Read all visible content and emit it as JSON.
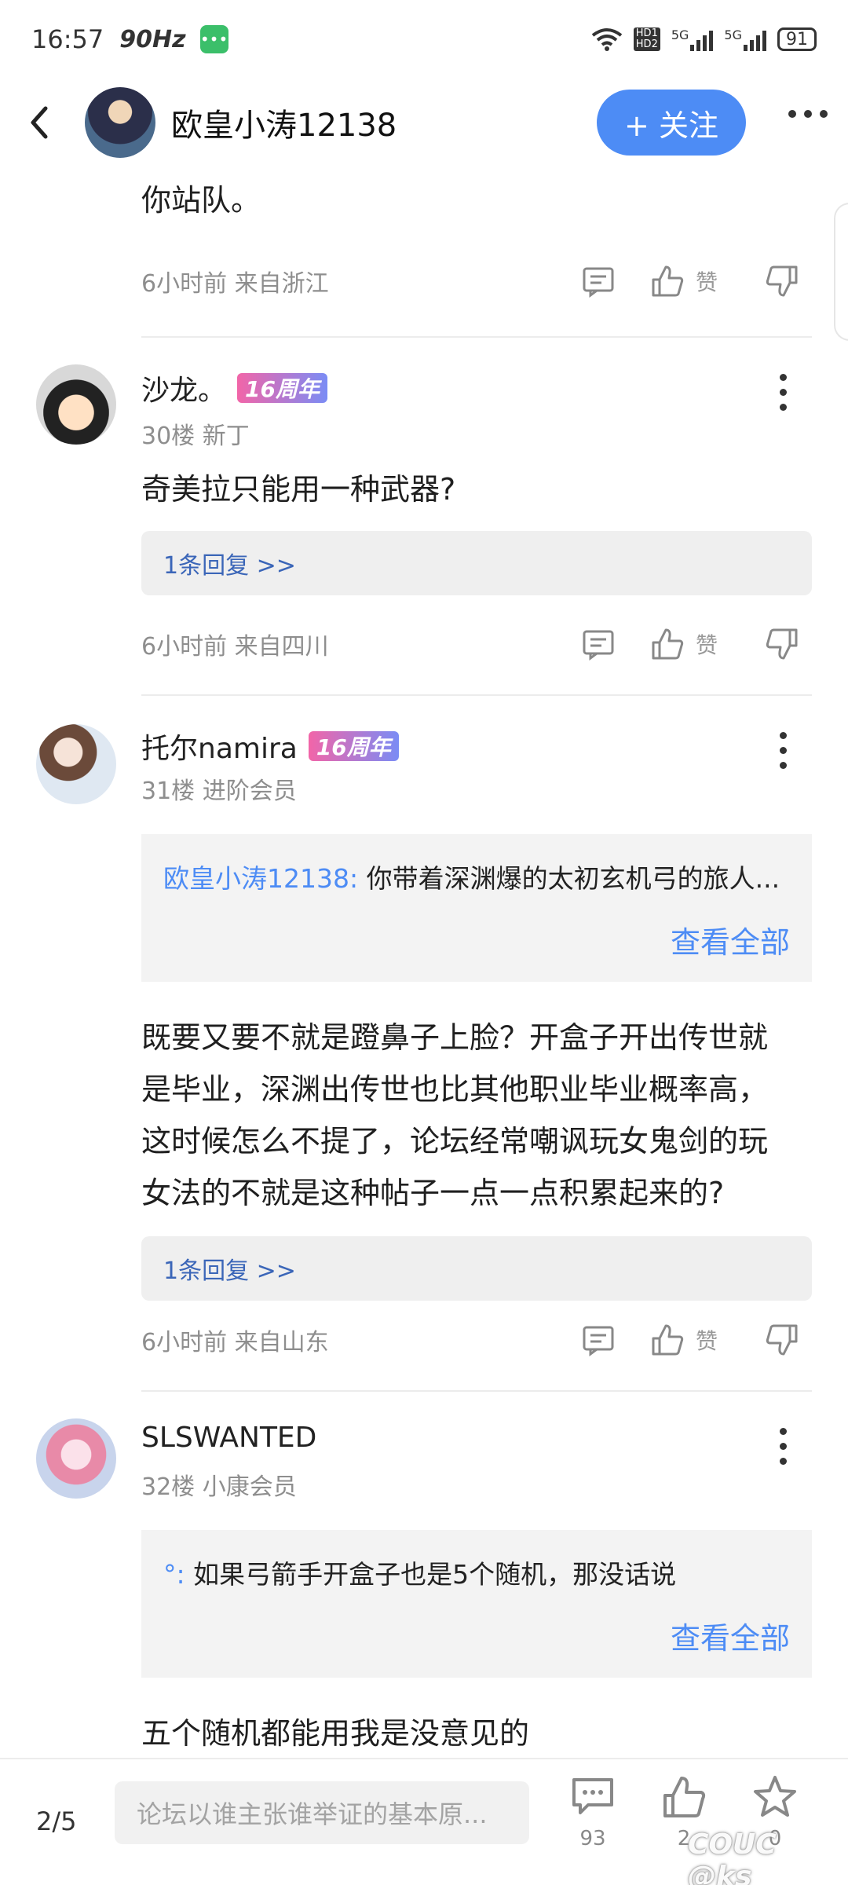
{
  "status_bar": {
    "time": "16:57",
    "refresh_rate": "90Hz",
    "hd1": "HD1",
    "hd2": "HD2",
    "net1": "5G",
    "net2": "5G",
    "battery": "91"
  },
  "header": {
    "username": "欧皇小涛12138",
    "follow_label": "+ 关注"
  },
  "top_fragment": {
    "text": "你站队。",
    "meta": "6小时前 来自浙江",
    "like_label": "赞"
  },
  "comments": [
    {
      "name": "沙龙。",
      "badge": "16周年",
      "sub": "30楼 新丁",
      "text": "奇美拉只能用一种武器?",
      "replies": "1条回复 >>",
      "meta": "6小时前 来自四川",
      "like_label": "赞"
    },
    {
      "name": "托尔namira",
      "badge": "16周年",
      "sub": "31楼 进阶会员",
      "quote_author": "欧皇小涛12138:",
      "quote_text": " 你带着深渊爆的太初玄机弓的旅人...",
      "quote_more": "查看全部",
      "text_lines": [
        "既要又要不就是蹬鼻子上脸？开盒子开出传世就",
        "是毕业，深渊出传世也比其他职业毕业概率高，",
        "这时候怎么不提了，论坛经常嘲讽玩女鬼剑的玩",
        "女法的不就是这种帖子一点一点积累起来的?"
      ],
      "replies": "1条回复 >>",
      "meta": "6小时前 来自山东",
      "like_label": "赞"
    },
    {
      "name": "SLSWANTED",
      "sub": "32楼 小康会员",
      "quote_author": "°:",
      "quote_text": " 如果弓箭手开盒子也是5个随机，那没话说",
      "quote_more": "查看全部",
      "text": "五个随机都能用我是没意见的"
    }
  ],
  "bottom_bar": {
    "page": "2/5",
    "input_placeholder": "论坛以谁主张谁举证的基本原...",
    "comment_count": "93",
    "like_count": "2",
    "fav_count": "0"
  },
  "watermark": "COUC @ks",
  "colors": {
    "accent": "#4d8cf5",
    "reply_link": "#3b66b8",
    "meta_gray": "#8e8e8e"
  }
}
